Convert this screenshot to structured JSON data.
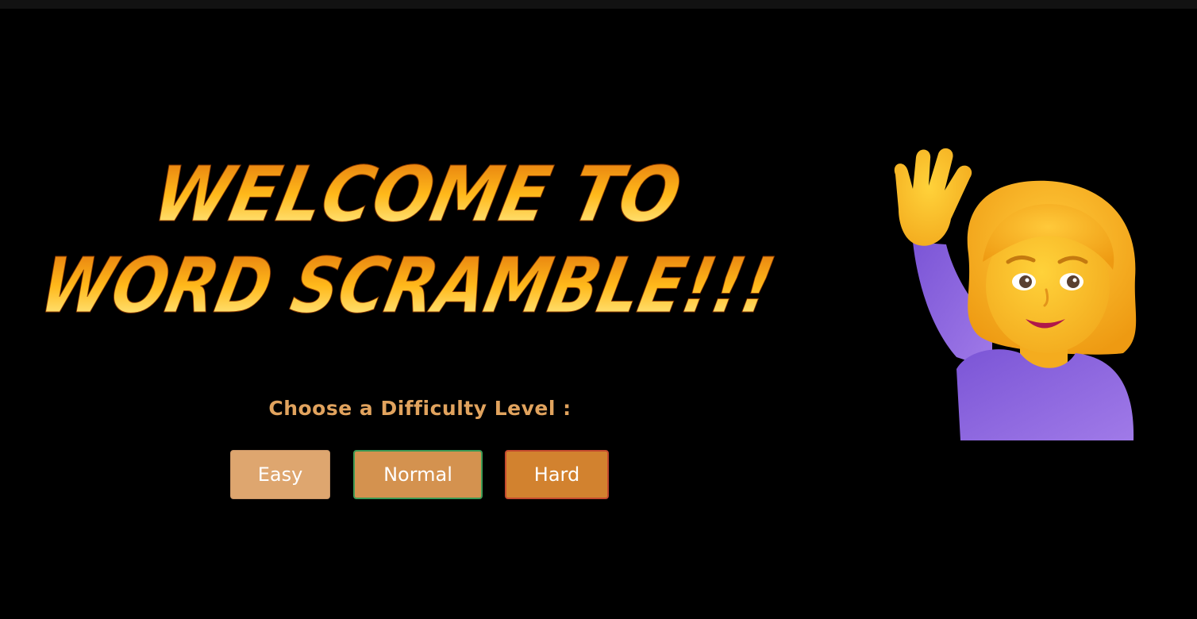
{
  "title": {
    "line1": "WELCOME TO",
    "line2": "WORD SCRAMBLE!!!"
  },
  "prompt": "Choose a Difficulty Level :",
  "buttons": {
    "easy": "Easy",
    "normal": "Normal",
    "hard": "Hard"
  },
  "illustration": {
    "icon": "woman-raising-hand-icon"
  },
  "colors": {
    "background": "#000000",
    "title_gradient_top": "#e67a10",
    "title_gradient_bottom": "#fff48a",
    "prompt": "#e1a35e",
    "easy_button": "#dea66f",
    "normal_button": "#d4924f",
    "hard_button": "#d2822f"
  }
}
